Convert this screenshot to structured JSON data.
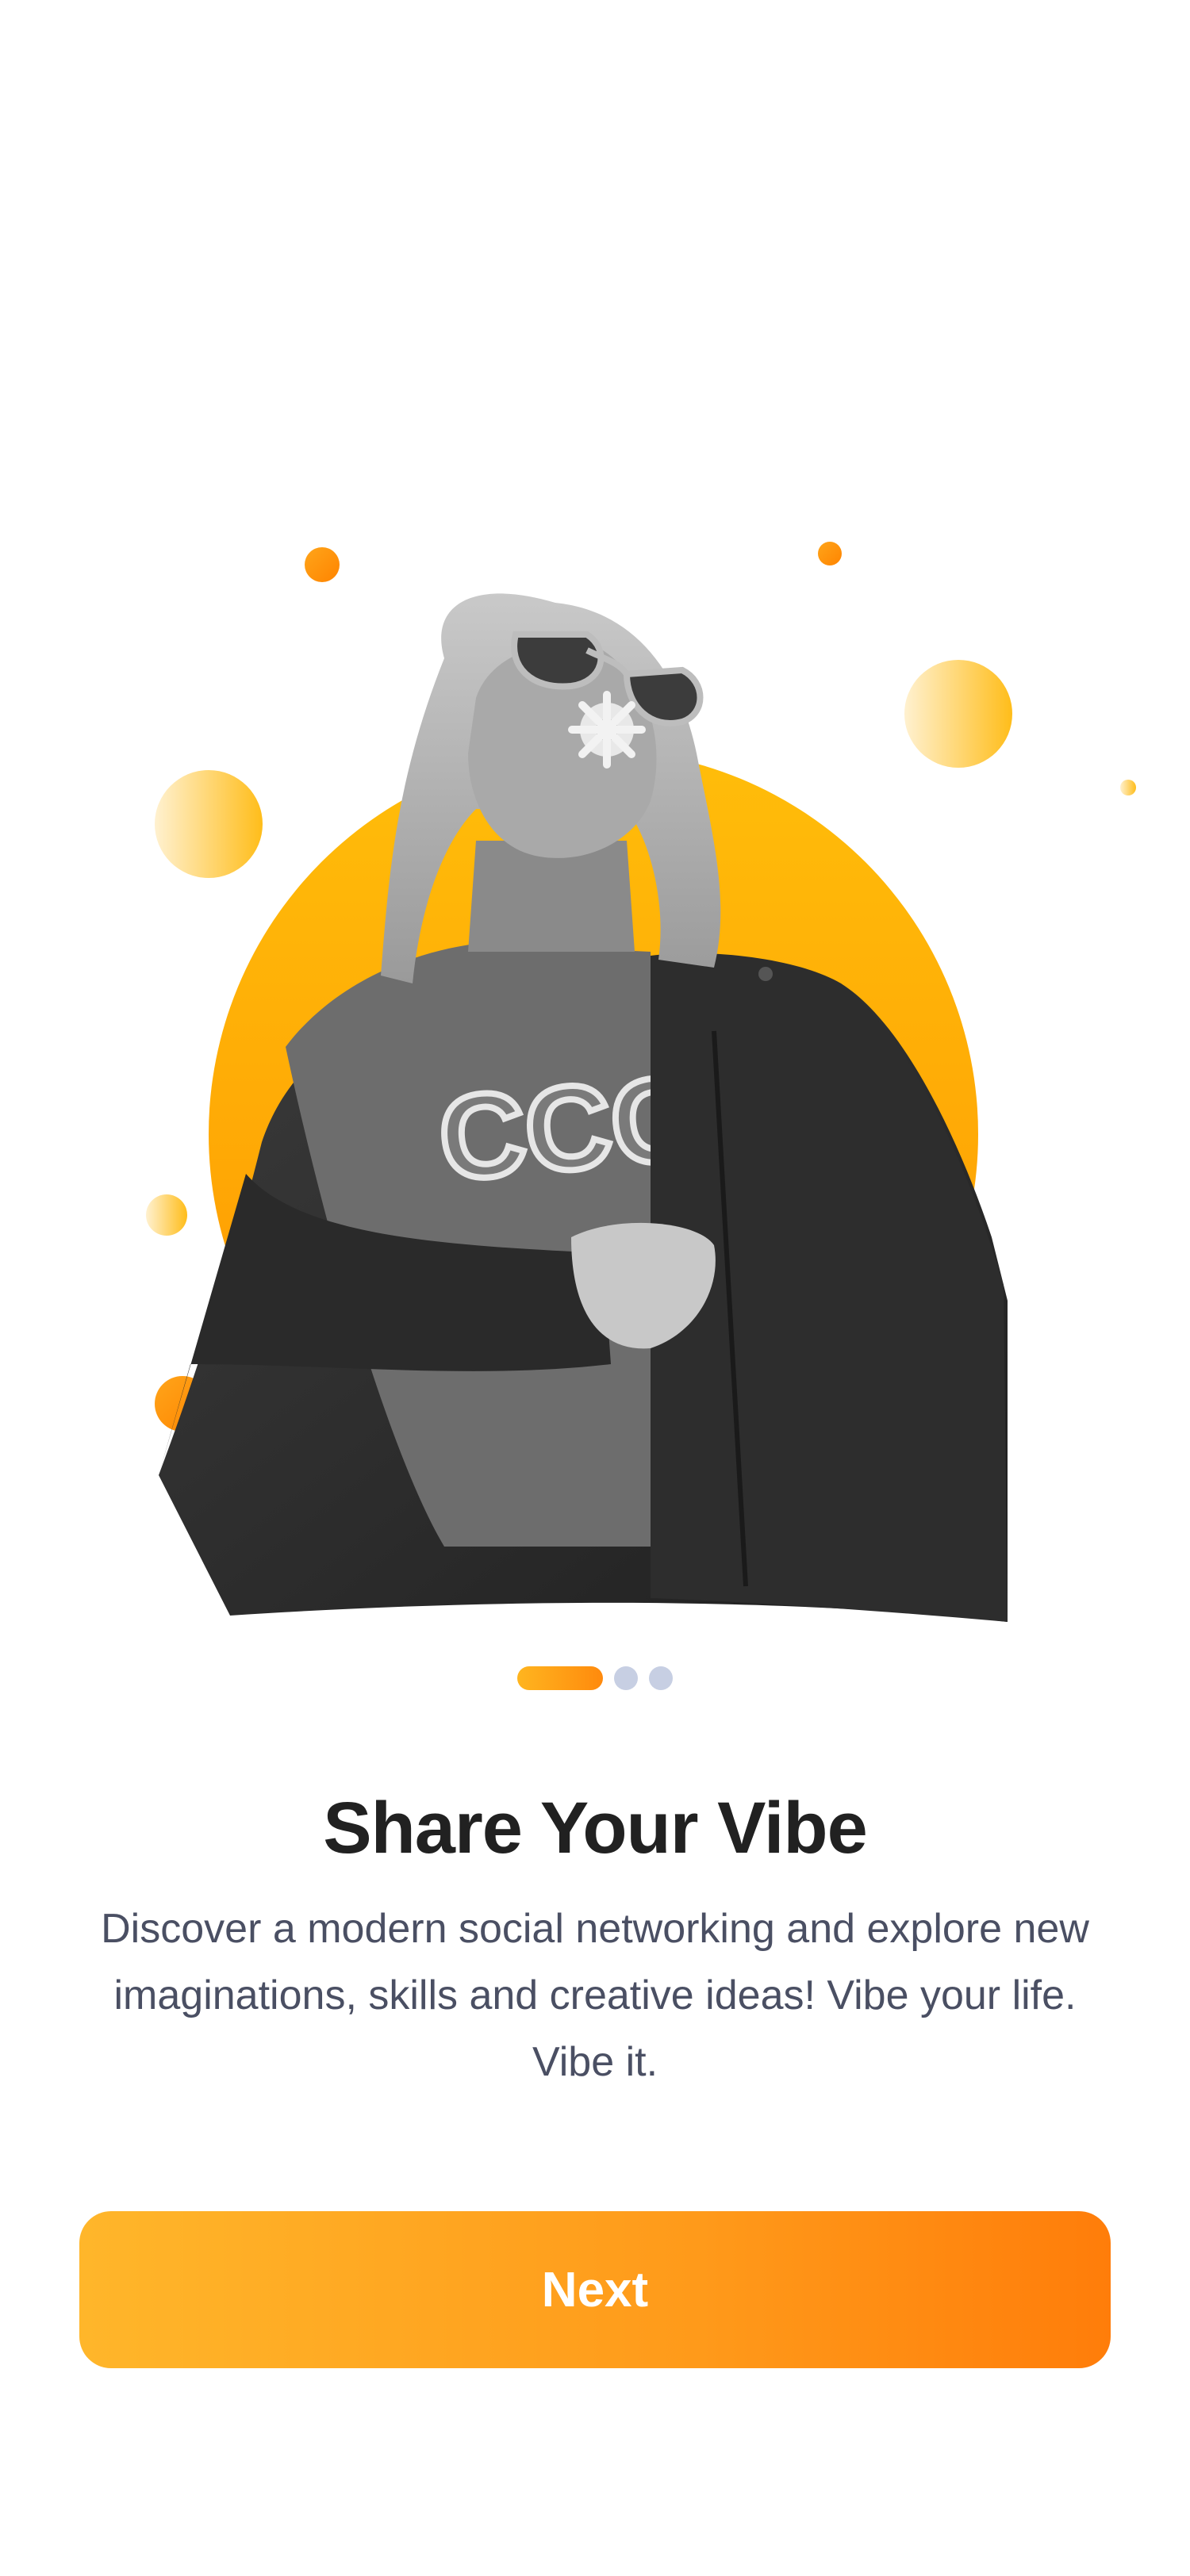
{
  "onboarding": {
    "title": "Share Your Vibe",
    "description": "Discover a modern social networking and explore new imaginations, skills and creative ideas! Vibe your life. Vibe it.",
    "next_label": "Next",
    "total_pages": 3,
    "current_page": 1
  },
  "hero": {
    "shirt_text": "CCC"
  },
  "colors": {
    "accent_start": "#ffb62a",
    "accent_end": "#ff7d0a",
    "inactive_dot": "#c7cfe3",
    "title": "#212121",
    "body_text": "#4a4f63"
  }
}
